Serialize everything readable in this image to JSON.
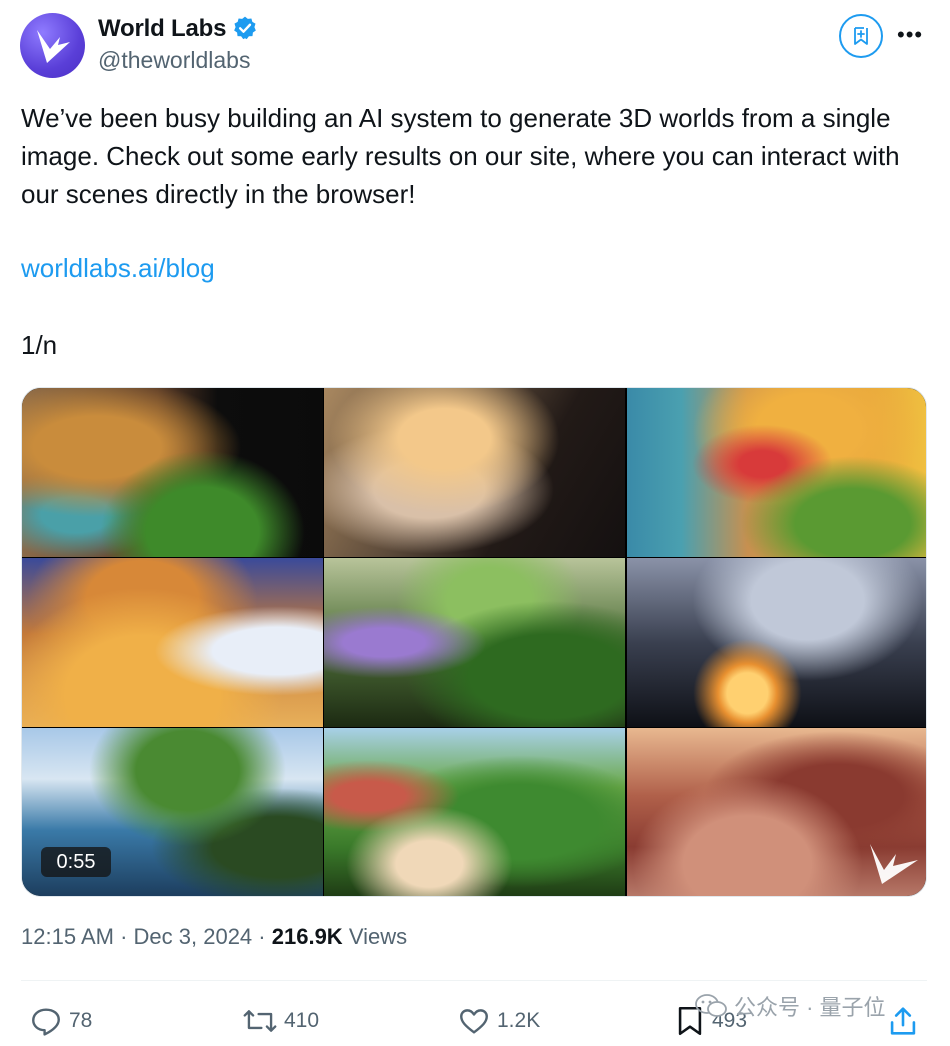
{
  "author": {
    "display_name": "World Labs",
    "handle": "@theworldlabs",
    "verified_icon": "verified-badge-icon",
    "brand_color": "#5a3fd8"
  },
  "tweet": {
    "text": "We’ve been busy building an AI system to generate 3D worlds from a single image. Check out some early results on our site, where you can interact with our scenes directly in the browser!",
    "link": "worldlabs.ai/blog",
    "counter": "1/n"
  },
  "media": {
    "duration": "0:55",
    "tiles": [
      "fantasy-cave-temple",
      "misty-forest-valley",
      "colorful-seaside-village",
      "cartoon-ruins-courtyard",
      "garden-path",
      "futuristic-hall",
      "lake-house-island",
      "hillside-village-road",
      "desert-canyon"
    ]
  },
  "meta": {
    "time": "12:15 AM",
    "date": "Dec 3, 2024",
    "views_count": "216.9K",
    "views_label": "Views"
  },
  "actions": {
    "replies": "78",
    "reposts": "410",
    "likes": "1.2K",
    "bookmarks": "493"
  },
  "watermark": "公众号 · 量子位",
  "colors": {
    "accent": "#1d9bf0",
    "text": "#0f1419",
    "muted": "#536471"
  }
}
